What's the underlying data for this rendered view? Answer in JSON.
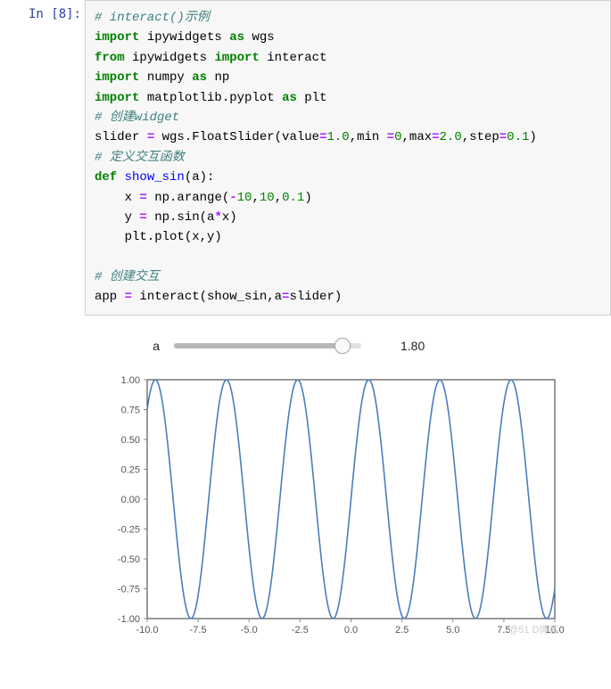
{
  "cell": {
    "prompt_label": "In  [8]:",
    "code": {
      "l1_comment": "# interact()示例",
      "l2_import": "import",
      "l2_mod": " ipywidgets ",
      "l2_as": "as",
      "l2_alias": " wgs",
      "l3_from": "from",
      "l3_mod": " ipywidgets ",
      "l3_import": "import",
      "l3_name": " interact",
      "l4_import": "import",
      "l4_mod": " numpy ",
      "l4_as": "as",
      "l4_alias": " np",
      "l5_import": "import",
      "l5_mod": " matplotlib.pyplot ",
      "l5_as": "as",
      "l5_alias": " plt",
      "l6_comment": "# 创建widget",
      "l7_pre": "slider ",
      "l7_eq": "=",
      "l7_call": " wgs.FloatSlider(value",
      "l7_eq2": "=",
      "l7_v1": "1.0",
      "l7_c1": ",min ",
      "l7_eq3": "=",
      "l7_v2": "0",
      "l7_c2": ",max",
      "l7_eq4": "=",
      "l7_v3": "2.0",
      "l7_c3": ",step",
      "l7_eq5": "=",
      "l7_v4": "0.1",
      "l7_end": ")",
      "l8_comment": "# 定义交互函数",
      "l9_def": "def",
      "l9_name": " show_sin",
      "l9_params": "(a):",
      "l10_pre": "    x ",
      "l10_eq": "=",
      "l10_call": " np.arange(",
      "l10_v1": "-",
      "l10_v1n": "10",
      "l10_c1": ",",
      "l10_v2": "10",
      "l10_c2": ",",
      "l10_v3": "0.1",
      "l10_end": ")",
      "l11_pre": "    y ",
      "l11_eq": "=",
      "l11_call": " np.sin(a",
      "l11_star": "*",
      "l11_end": "x)",
      "l12": "    plt.plot(x,y)",
      "l13": "",
      "l14_comment": "# 创建交互",
      "l15_pre": "app ",
      "l15_eq": "=",
      "l15_call": " interact(show_sin,a",
      "l15_eq2": "=",
      "l15_end": "slider)"
    }
  },
  "slider": {
    "label": "a",
    "value": "1.80",
    "min": 0,
    "max": 2.0,
    "current": 1.8
  },
  "chart_data": {
    "type": "line",
    "title": "",
    "xlabel": "",
    "ylabel": "",
    "xlim": [
      -10,
      10
    ],
    "ylim": [
      -1.0,
      1.0
    ],
    "x_ticks": [
      -10.0,
      -7.5,
      -5.0,
      -2.5,
      0.0,
      2.5,
      5.0,
      7.5,
      10.0
    ],
    "y_ticks": [
      -1.0,
      -0.75,
      -0.5,
      -0.25,
      0.0,
      0.25,
      0.5,
      0.75,
      1.0
    ],
    "series": [
      {
        "name": "sin(1.8·x)",
        "function": "y = sin(1.8*x)",
        "x_range": [
          -10,
          10
        ],
        "step": 0.1
      }
    ],
    "colors": {
      "line": "#4a7ebb"
    }
  },
  "watermark": "@51  D博客"
}
